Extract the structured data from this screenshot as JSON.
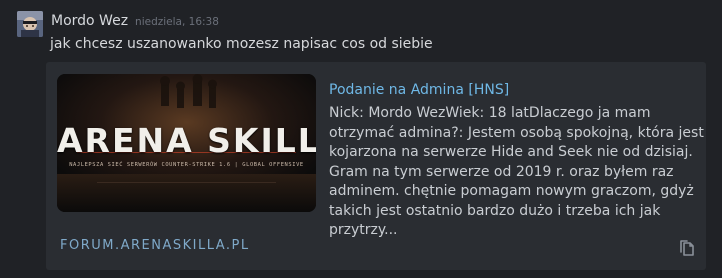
{
  "message": {
    "author": "Mordo Wez",
    "timestamp": "niedziela, 16:38",
    "text": "jak chcesz uszanowanko mozesz napisac cos od siebie"
  },
  "embed": {
    "image": {
      "title": "ARENA SKILLA",
      "subtitle": "NAJLEPSZA SIEĆ SERWERÓW COUNTER-STRIKE 1.6 | GLOBAL OFFENSIVE"
    },
    "title": "Podanie na Admina [HNS]",
    "description_lines": [
      "Nick: Mordo WezWiek: 18 latDlaczego ja mam",
      "otrzymać admina?: Jestem osobą spokojną, która jest",
      "kojarzona na serwerze Hide and Seek nie od dzisiaj.",
      "Gram na tym serwerze od 2019 r. oraz byłem raz",
      "adminem. chętnie pomagam nowym graczom, gdyż",
      "takich jest ostatnio bardzo dużo i trzeba ich jak",
      "przytrzy..."
    ],
    "domain": "FORUM.ARENASKILLA.PL"
  },
  "colors": {
    "background": "#202226",
    "card": "#2a2d32",
    "link": "#6fb8e6",
    "domain": "#7fa9c9",
    "brand_accent": "#d8452a"
  },
  "icons": {
    "copy": "copy-icon",
    "avatar": "avatar"
  }
}
